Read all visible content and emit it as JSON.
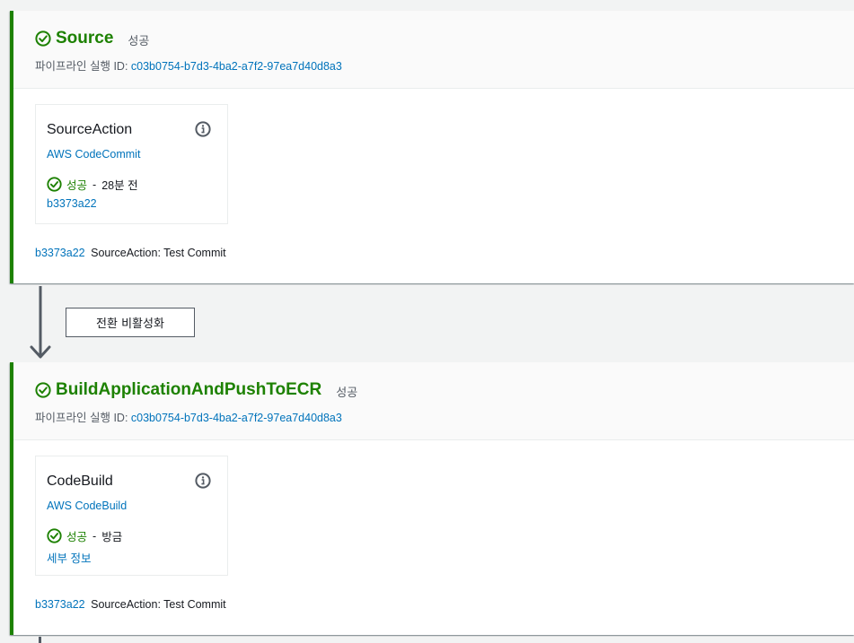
{
  "stages": [
    {
      "name": "Source",
      "status": "성공",
      "execution_label": "파이프라인 실행 ID:",
      "execution_id": "c03b0754-b7d3-4ba2-a7f2-97ea7d40d8a3",
      "action": {
        "name": "SourceAction",
        "provider": "AWS CodeCommit",
        "status": "성공",
        "separator": "-",
        "time": "28분 전",
        "link": "b3373a22"
      },
      "commit": {
        "id": "b3373a22",
        "message": "SourceAction: Test Commit"
      }
    },
    {
      "name": "BuildApplicationAndPushToECR",
      "status": "성공",
      "execution_label": "파이프라인 실행 ID:",
      "execution_id": "c03b0754-b7d3-4ba2-a7f2-97ea7d40d8a3",
      "action": {
        "name": "CodeBuild",
        "provider": "AWS CodeBuild",
        "status": "성공",
        "separator": "-",
        "time": "방금",
        "link": "세부 정보"
      },
      "commit": {
        "id": "b3373a22",
        "message": "SourceAction: Test Commit"
      }
    }
  ],
  "transition": {
    "button_label": "전환 비활성화"
  },
  "icons": {
    "success": "check-circle-icon",
    "info": "info-icon",
    "transition": "arrow-down-icon"
  },
  "colors": {
    "success": "#1d8102",
    "link": "#0073bb",
    "text": "#16191f",
    "muted": "#545b64",
    "background": "#f2f3f3"
  }
}
